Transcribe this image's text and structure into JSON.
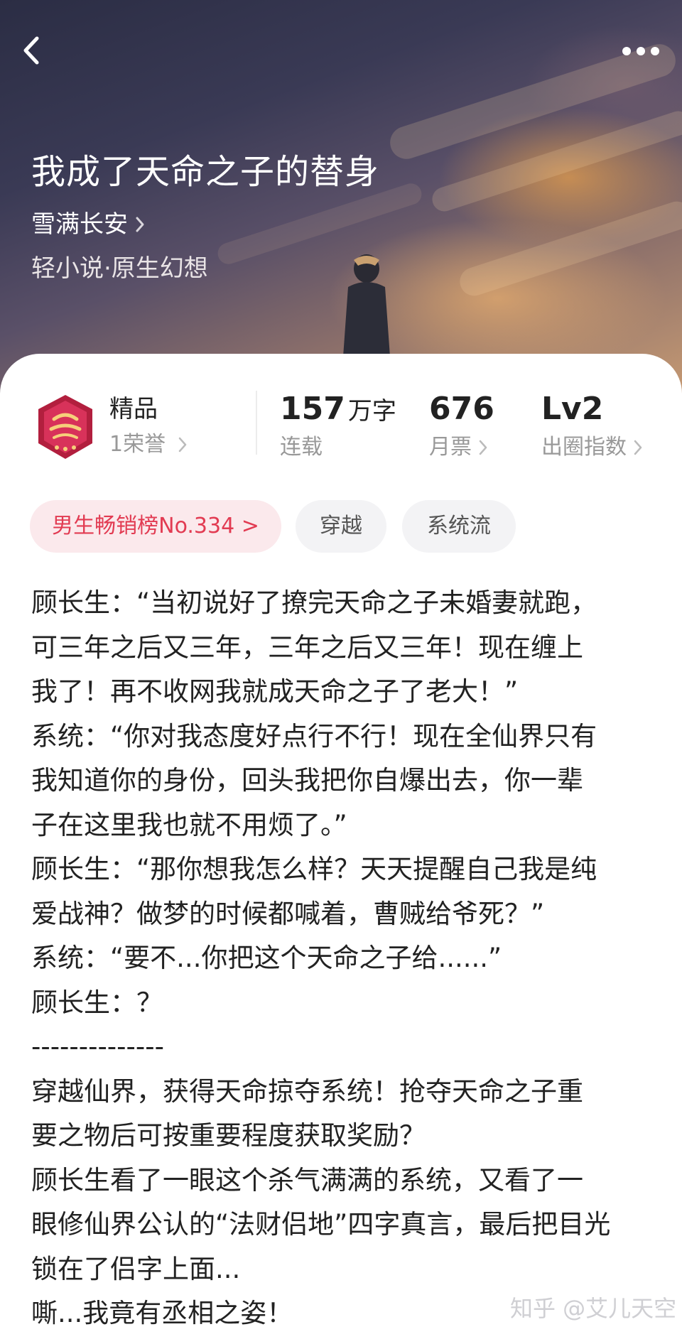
{
  "header": {
    "back_icon": "back-chevron-icon",
    "more_icon": "more-dots-icon"
  },
  "book": {
    "title": "我成了天命之子的替身",
    "author": "雪满长安",
    "genre": "轻小说·原生幻想"
  },
  "honor": {
    "title": "精品",
    "subtitle": "1荣誉",
    "badge_icon": "premium-badge-icon"
  },
  "stats": [
    {
      "value": "157",
      "unit": "万字",
      "label": "连载"
    },
    {
      "value": "676",
      "unit": "",
      "label": "月票"
    },
    {
      "value": "Lv2",
      "unit": "",
      "label": "出圈指数"
    }
  ],
  "tags": {
    "rank": "男生畅销榜No.334 >",
    "items": [
      "穿越",
      "系统流"
    ]
  },
  "synopsis": [
    "顾长生：“当初说好了撩完天命之子未婚妻就跑，",
    "可三年之后又三年，三年之后又三年！现在缠上",
    "我了！再不收网我就成天命之子了老大！”",
    "系统：“你对我态度好点行不行！现在全仙界只有",
    "我知道你的身份，回头我把你自爆出去，你一辈",
    "子在这里我也就不用烦了。”",
    "顾长生：“那你想我怎么样？天天提醒自己我是纯",
    "爱战神？做梦的时候都喊着，曹贼给爷死？”",
    "系统：“要不...你把这个天命之子给......”",
    "顾长生：？",
    "--------------",
    "穿越仙界，获得天命掠夺系统！抢夺天命之子重",
    "要之物后可按重要程度获取奖励？",
    "顾长生看了一眼这个杀气满满的系统，又看了一",
    "眼修仙界公认的“法财侣地”四字真言，最后把目光",
    "锁在了侣字上面...",
    "嘶...我竟有丞相之姿！"
  ],
  "watermark": "知乎 @艾儿天空",
  "colors": {
    "rank_tag_bg": "#fbe9ec",
    "rank_tag_text": "#e23b52",
    "plain_tag_bg": "#f3f3f5"
  }
}
